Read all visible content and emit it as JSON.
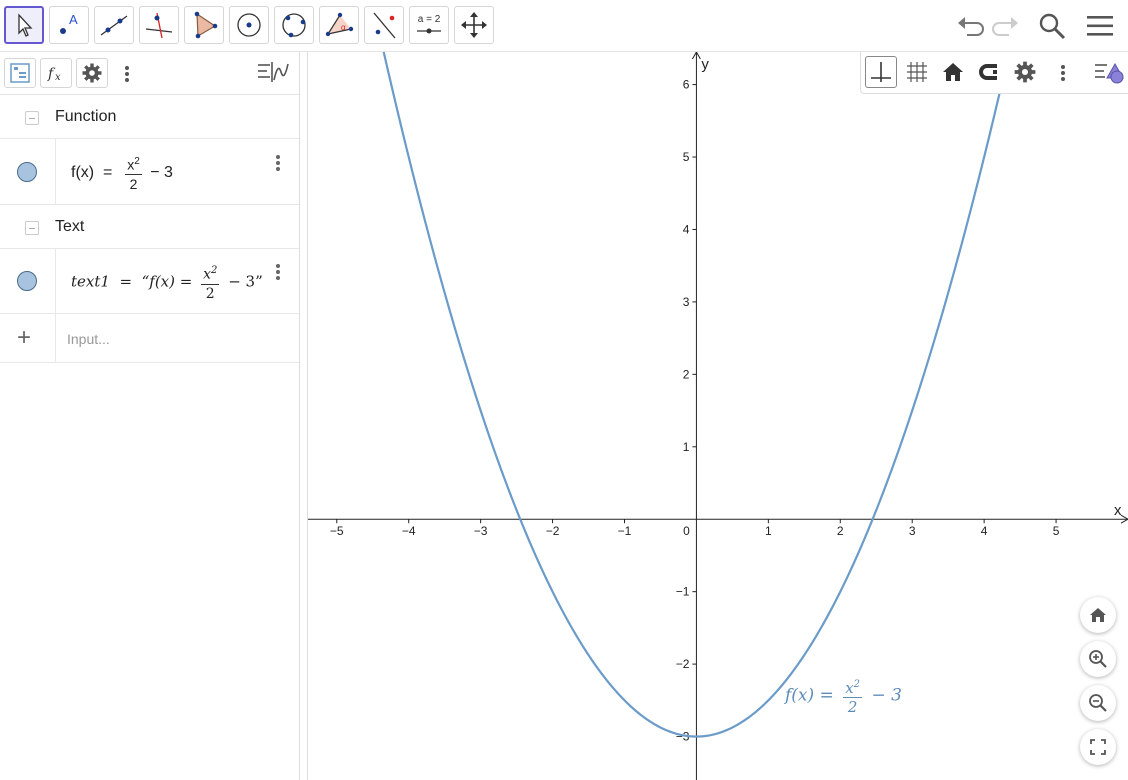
{
  "toolbar": {
    "tools": [
      {
        "name": "move-tool",
        "icon": "arrow-cursor-icon"
      },
      {
        "name": "point-tool",
        "icon": "point-icon"
      },
      {
        "name": "line-tool",
        "icon": "line-icon"
      },
      {
        "name": "perpendicular-line-tool",
        "icon": "perpendicular-icon"
      },
      {
        "name": "polygon-tool",
        "icon": "polygon-icon"
      },
      {
        "name": "circle-center-point-tool",
        "icon": "circle-center-icon"
      },
      {
        "name": "circle-three-points-tool",
        "icon": "circle-three-points-icon"
      },
      {
        "name": "angle-tool",
        "icon": "angle-icon"
      },
      {
        "name": "reflect-tool",
        "icon": "reflect-icon"
      },
      {
        "name": "slider-tool",
        "icon": "slider-icon",
        "label": "a = 2"
      },
      {
        "name": "move-graphics-tool",
        "icon": "move-graphics-icon"
      }
    ],
    "right_icons": [
      "undo-icon",
      "redo-icon",
      "search-icon",
      "menu-icon"
    ]
  },
  "algebra": {
    "groups": [
      {
        "label": "Function",
        "item": {
          "name": "f(x)",
          "lhs": "f(x)",
          "num_base": "x",
          "num_exp": "2",
          "den": "2",
          "tail": "− 3"
        }
      },
      {
        "label": "Text",
        "item": {
          "name": "text1",
          "lhs": "text1",
          "open_quote": "“f(x) =",
          "num_base": "x",
          "num_exp": "2",
          "den": "2",
          "tail": "− 3”"
        }
      }
    ],
    "input_placeholder": "Input..."
  },
  "graphics": {
    "x_axis_label": "x",
    "y_axis_label": "y",
    "x_tick_labels": [
      "−5",
      "−4",
      "−3",
      "−2",
      "−1",
      "0",
      "1",
      "2",
      "3",
      "4",
      "5"
    ],
    "y_tick_labels": [
      "6",
      "5",
      "4",
      "3",
      "2",
      "1",
      "−1",
      "−2",
      "−3"
    ],
    "plot_label": {
      "lhs": "f(x) =",
      "num_base": "x",
      "num_exp": "2",
      "den": "2",
      "tail": "− 3"
    },
    "curve_color": "#6b9bc8",
    "function": {
      "a": 0.5,
      "c": -3
    },
    "x_range": [
      -5.4,
      6.0
    ],
    "y_range": [
      -3.6,
      6.45
    ]
  },
  "colors": {
    "accent": "#6557d2",
    "marble_fill": "#a7c3e0"
  }
}
